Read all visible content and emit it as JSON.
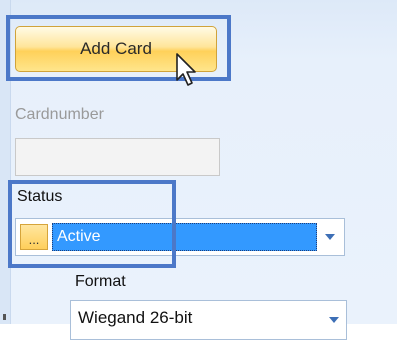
{
  "toolbar": {
    "add_card_label": "Add Card"
  },
  "fields": {
    "cardnumber_label": "Cardnumber",
    "cardnumber_value": "",
    "status_label": "Status",
    "status_ellipsis": "...",
    "status_value": "Active",
    "format_label": "Format",
    "format_value": "Wiegand 26-bit"
  },
  "colors": {
    "highlight_border": "#4c78c8",
    "selection_blue": "#3399ff",
    "button_gold": "#ffd15a"
  },
  "icons": {
    "cursor": "mouse-pointer-icon",
    "status_dropdown": "chevron-down-icon",
    "format_dropdown": "chevron-down-icon"
  }
}
